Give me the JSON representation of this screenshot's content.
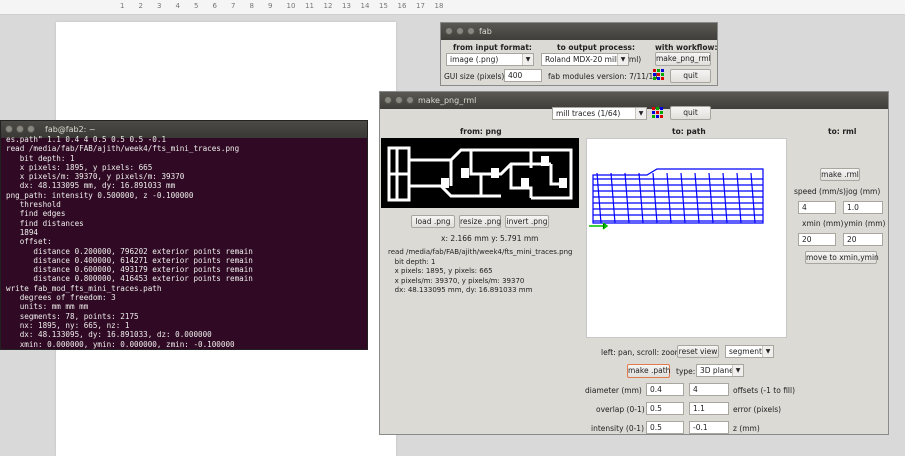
{
  "ruler": {
    "ticks": [
      "1",
      "2",
      "3",
      "4",
      "5",
      "6",
      "7",
      "8",
      "9",
      "10",
      "11",
      "12",
      "13",
      "14",
      "15",
      "16",
      "17",
      "18"
    ]
  },
  "terminal": {
    "title": "fab@fab2: ~",
    "lines": [
      "es.path\" 1.1 0.4 4 0.5 0.5 0.5 -0.1",
      "read /media/fab/FAB/ajith/week4/fts_mini_traces.png",
      "   bit depth: 1",
      "   x pixels: 1895, y pixels: 665",
      "   x pixels/m: 39370, y pixels/m: 39370",
      "   dx: 48.133095 mm, dy: 16.891033 mm",
      "png_path: intensity 0.500000, z -0.100000",
      "   threshold",
      "   find edges",
      "   find distances",
      "   1894",
      "   offset:",
      "      distance 0.200000, 796202 exterior points remain",
      "      distance 0.400000, 614271 exterior points remain",
      "      distance 0.600000, 493179 exterior points remain",
      "      distance 0.800000, 416453 exterior points remain",
      "write fab_mod_fts_mini_traces.path",
      "   degrees of freedom: 3",
      "   units: mm mm mm",
      "   segments: 78, points: 2175",
      "   nx: 1895, ny: 665, nz: 1",
      "   dx: 48.133095, dy: 16.891033, dz: 0.000000",
      "   xmin: 0.000000, ymin: 0.000000, zmin: -0.100000",
      ""
    ]
  },
  "fab": {
    "title": "fab",
    "header_input": "from input format:",
    "header_output": "to output process:",
    "header_workflow": "with workflow:",
    "input_format": "image (.png)",
    "output_process": "Roland MDX-20 mill (.rml)",
    "workflow": "make_png_rml",
    "gui_size_label": "GUI size (pixels):",
    "gui_size_value": "400",
    "version": "fab modules version: 7/11/14",
    "quit": "quit"
  },
  "rml": {
    "title": "make_png_rml",
    "process": "mill traces (1/64)",
    "quit": "quit",
    "from_png": "from: png",
    "to_path": "to: path",
    "to_rml": "to: rml",
    "load_png": "load .png",
    "resize_png": "resize .png",
    "invert_png": "invert .png",
    "coords": "x: 2.166 mm  y: 5.791 mm",
    "info": [
      "read /media/fab/FAB/ajith/week4/fts_mini_traces.png",
      "   bit depth: 1",
      "   x pixels: 1895, y pixels: 665",
      "   x pixels/m: 39370, y pixels/m: 39370",
      "   dx: 48.133095 mm, dy: 16.891033 mm"
    ],
    "make_rml": "make .rml",
    "speed_label": "speed (mm/s)",
    "jog_label": "jog (mm)",
    "speed": "4",
    "jog": "1.0",
    "xmin_label": "xmin (mm)",
    "ymin_label": "ymin (mm)",
    "xmin": "20",
    "ymin": "20",
    "move_xy": "move to xmin,ymin",
    "pan_hint": "left: pan, scroll: zoom",
    "reset_view": "reset view",
    "view_mode": "segments",
    "make_path": "make .path",
    "type_label": "type:",
    "type_value": "3D plane",
    "diameter_label": "diameter (mm)",
    "diameter": "0.4",
    "offsets": "4",
    "offsets_label": "offsets (-1 to fill)",
    "overlap_label": "overlap (0-1)",
    "overlap": "0.5",
    "error": "1.1",
    "error_label": "error (pixels)",
    "intensity_label": "intensity (0-1)",
    "intensity": "0.5",
    "z": "-0.1",
    "z_label": "z (mm)"
  },
  "colors": {
    "terminal_bg": "#300a24",
    "path_blue": "#0000ff",
    "path_green": "#00c000"
  }
}
